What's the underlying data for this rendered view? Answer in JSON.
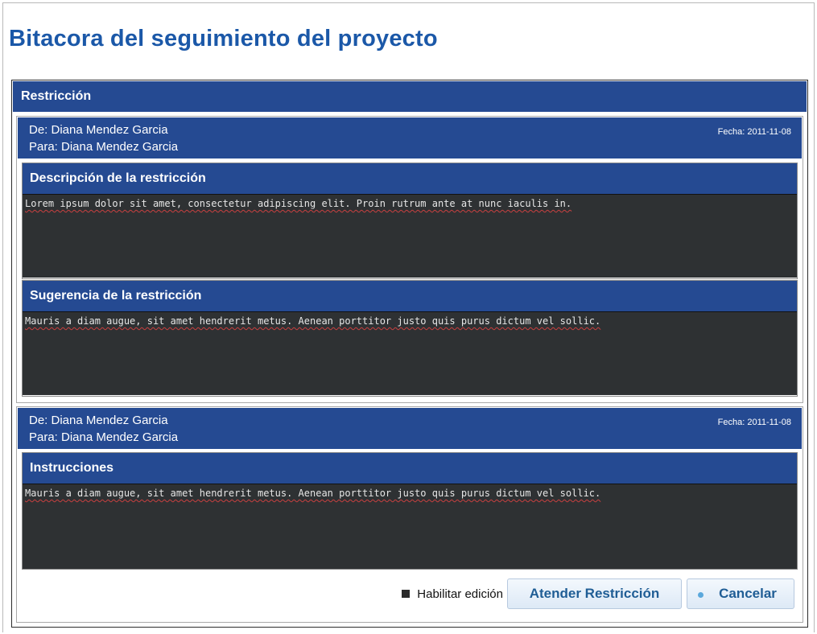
{
  "page": {
    "title": "Bitacora del seguimiento del proyecto"
  },
  "panel": {
    "title": "Restricción"
  },
  "messages": [
    {
      "from": "De: Diana Mendez Garcia",
      "to": "Para: Diana Mendez Garcia",
      "date": "Fecha: 2011-11-08",
      "sections": [
        {
          "title": "Descripción de la restricción",
          "text": "Lorem ipsum dolor sit amet, consectetur adipiscing elit. Proin rutrum ante at nunc iaculis in."
        },
        {
          "title": "Sugerencia de la restricción",
          "text": "Mauris a diam augue, sit amet hendrerit metus. Aenean porttitor justo quis purus dictum vel sollic."
        }
      ]
    },
    {
      "from": "De: Diana Mendez Garcia",
      "to": "Para: Diana Mendez Garcia",
      "date": "Fecha: 2011-11-08",
      "sections": [
        {
          "title": "Instrucciones",
          "text": "Mauris a diam augue, sit amet hendrerit metus. Aenean porttitor justo quis purus dictum vel sollic."
        }
      ]
    }
  ],
  "actions": {
    "enable_edit_label": "Habilitar edición",
    "enable_edit_checked": true,
    "attend_label": "Atender Restricción",
    "cancel_label": "Cancelar"
  },
  "colors": {
    "header_blue": "#254a92",
    "title_blue": "#1b58a8",
    "editor_bg": "#2e3133"
  }
}
